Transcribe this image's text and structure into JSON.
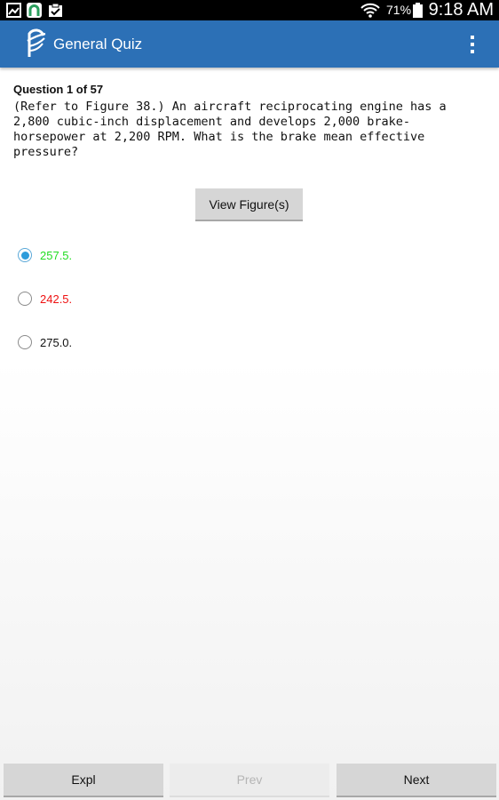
{
  "status_bar": {
    "battery_percent": "71%",
    "time": "9:18 AM"
  },
  "app_bar": {
    "title": "General Quiz"
  },
  "question": {
    "header": "Question 1 of 57",
    "text": "(Refer to Figure 38.) An aircraft reciprocating engine has a\n2,800 cubic-inch displacement and develops 2,000 brake-\nhorsepower at 2,200 RPM. What is the brake mean effective\npressure?",
    "view_figure_label": "View Figure(s)"
  },
  "options": [
    {
      "label": "257.5.",
      "selected": true,
      "color": "#22dd22"
    },
    {
      "label": "242.5.",
      "selected": false,
      "color": "#ee1111"
    },
    {
      "label": "275.0.",
      "selected": false,
      "color": "#111111"
    }
  ],
  "nav": {
    "expl_label": "Expl",
    "prev_label": "Prev",
    "next_label": "Next"
  },
  "colors": {
    "app_bar": "#2c70b6",
    "correct": "#22dd22",
    "incorrect": "#ee1111"
  }
}
